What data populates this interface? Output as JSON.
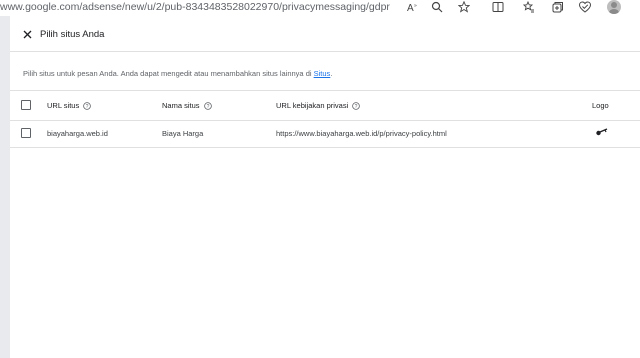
{
  "browser": {
    "url": "www.google.com/adsense/new/u/2/pub-8343483528022970/privacymessaging/gdpr",
    "icons": [
      "read-aloud-icon",
      "zoom-icon",
      "favorite-star-icon",
      "split-screen-icon",
      "favorites-icon",
      "collections-icon",
      "browser-essentials-icon",
      "profile-avatar-icon"
    ]
  },
  "dialog": {
    "title": "Pilih situs Anda",
    "description_prefix": "Pilih situs untuk pesan Anda. Anda dapat mengedit atau menambahkan situs lainnya di ",
    "description_link": "Situs",
    "description_suffix": "."
  },
  "table": {
    "columns": {
      "site_url": "URL situs",
      "site_name": "Nama situs",
      "privacy_url": "URL kebijakan privasi",
      "logo": "Logo"
    },
    "rows": [
      {
        "site_url": "biayaharga.web.id",
        "site_name": "Biaya Harga",
        "privacy_url": "https://www.biayaharga.web.id/p/privacy-policy.html",
        "logo": "key-icon"
      }
    ]
  },
  "colors": {
    "link": "#1a73e8",
    "text": "#202124",
    "muted": "#5f6368",
    "divider": "#e0e0e0"
  }
}
